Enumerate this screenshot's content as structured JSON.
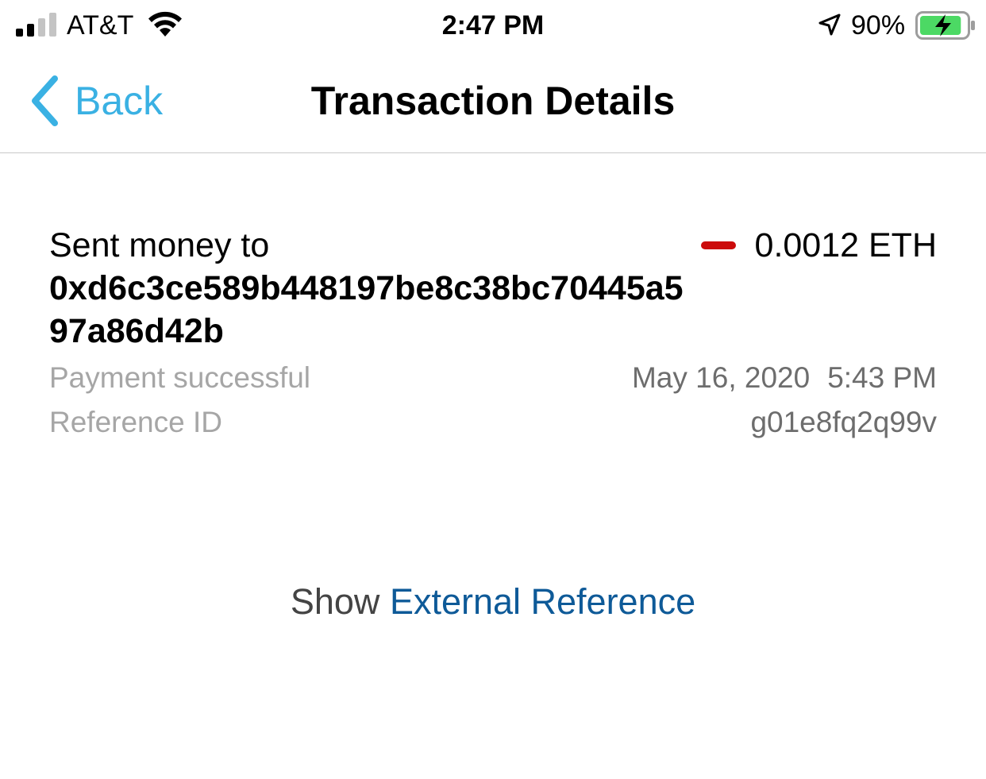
{
  "status_bar": {
    "carrier": "AT&T",
    "time": "2:47 PM",
    "battery_percent": "90%",
    "battery_level": 0.9,
    "charging": true,
    "signal_bars_filled": 2,
    "signal_bars_total": 4
  },
  "nav": {
    "back_label": "Back",
    "title": "Transaction Details"
  },
  "transaction": {
    "direction_label": "Sent money to",
    "address": "0xd6c3ce589b448197be8c38bc70445a597a86d42b",
    "amount": "0.0012 ETH",
    "status": "Payment successful",
    "date": "May 16, 2020",
    "time": "5:43 PM",
    "reference_label": "Reference ID",
    "reference_id": "g01e8fq2q99v"
  },
  "external_reference": {
    "prefix": "Show",
    "link_text": "External Reference"
  },
  "colors": {
    "accent": "#3ab1e3",
    "link": "#0e5a98",
    "negative": "#cc0b0b",
    "muted": "#a6a6a6",
    "battery_fill": "#4cd964"
  }
}
